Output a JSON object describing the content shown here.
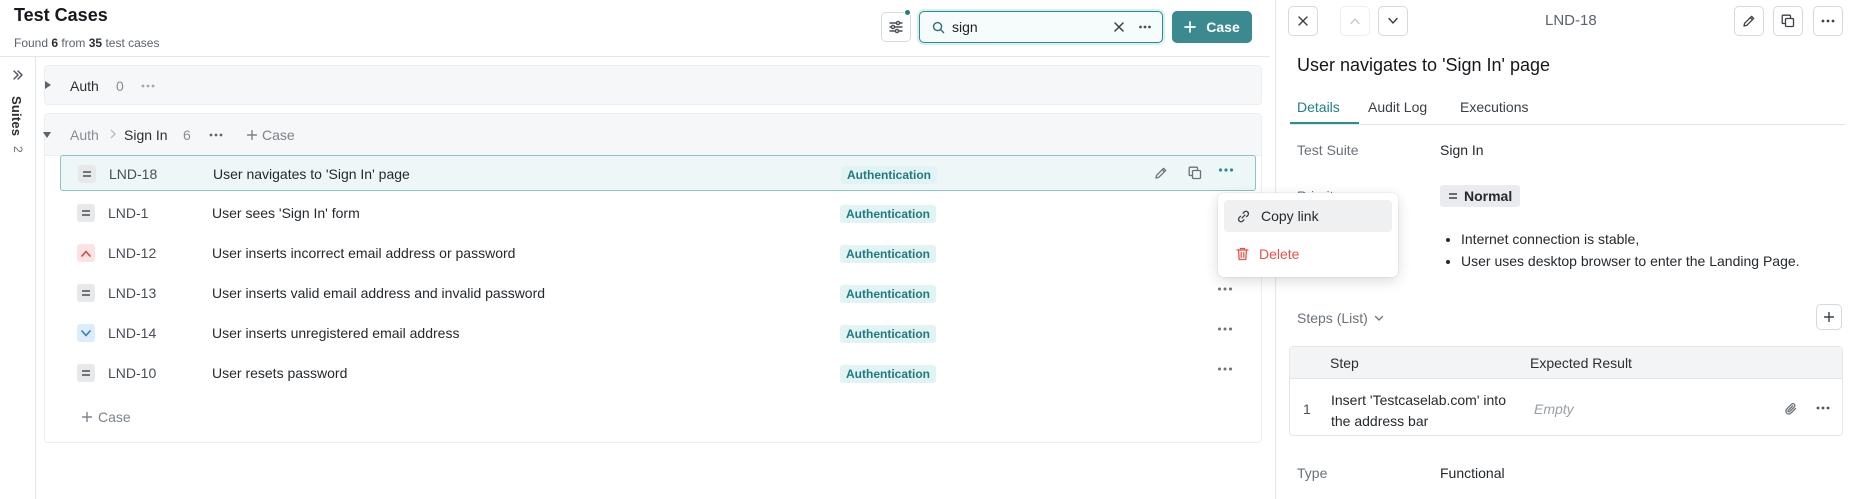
{
  "header": {
    "title": "Test Cases",
    "found_prefix": "Found",
    "found_count": "6",
    "found_mid": "from",
    "found_total": "35",
    "found_suffix": "test cases"
  },
  "search": {
    "value": "sign",
    "placeholder": ""
  },
  "toolbar": {
    "add_case_label": "Case"
  },
  "suites_rail": {
    "label": "Suites",
    "count": "2"
  },
  "suites": [
    {
      "name": "Auth",
      "count": "0"
    },
    {
      "parent": "Auth",
      "name": "Sign In",
      "count": "6",
      "add_case_label": "Case"
    }
  ],
  "cases": [
    {
      "id": "LND-18",
      "title": "User navigates to 'Sign In' page",
      "tag": "Authentication",
      "priority": "normal"
    },
    {
      "id": "LND-1",
      "title": "User sees 'Sign In' form",
      "tag": "Authentication",
      "priority": "normal"
    },
    {
      "id": "LND-12",
      "title": "User inserts incorrect email address or password",
      "tag": "Authentication",
      "priority": "high"
    },
    {
      "id": "LND-13",
      "title": "User inserts valid email address and invalid password",
      "tag": "Authentication",
      "priority": "normal"
    },
    {
      "id": "LND-14",
      "title": "User inserts unregistered email address",
      "tag": "Authentication",
      "priority": "low"
    },
    {
      "id": "LND-10",
      "title": "User resets password",
      "tag": "Authentication",
      "priority": "normal"
    }
  ],
  "add_case_inline": "Case",
  "context_menu": {
    "copy_link": "Copy link",
    "delete": "Delete"
  },
  "detail": {
    "case_id": "LND-18",
    "title": "User navigates to 'Sign In' page",
    "tabs": [
      "Details",
      "Audit Log",
      "Executions"
    ],
    "test_suite_label": "Test Suite",
    "test_suite_value": "Sign In",
    "priority_label": "Priority",
    "priority_value": "Normal",
    "preconditions": [
      "Internet connection is stable,",
      "User uses desktop browser to enter the Landing Page."
    ],
    "steps_header": "Steps (List)",
    "steps_columns": [
      "Step",
      "Expected Result"
    ],
    "steps": [
      {
        "num": "1",
        "text": "Insert 'Testcaselab.com' into the address bar",
        "expected": "Empty"
      }
    ],
    "type_label": "Type",
    "type_value": "Functional"
  },
  "colors": {
    "accent": "#3b8a8f",
    "tag_bg": "#e2f3f4",
    "tag_text": "#217a80",
    "danger": "#e5534b"
  }
}
